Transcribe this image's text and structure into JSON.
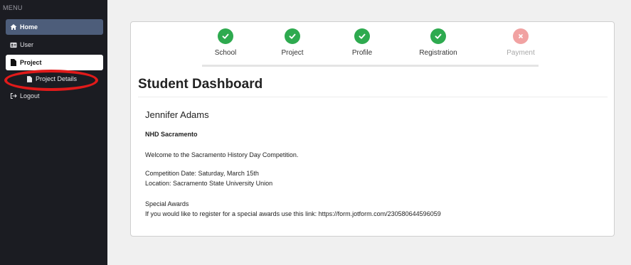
{
  "sidebar": {
    "menu_label": "MENU",
    "items": [
      {
        "label": "Home"
      },
      {
        "label": "User"
      },
      {
        "label": "Project"
      },
      {
        "label": "Project Details"
      },
      {
        "label": "Logout"
      }
    ]
  },
  "steps": [
    {
      "label": "School",
      "status": "done"
    },
    {
      "label": "Project",
      "status": "done"
    },
    {
      "label": "Profile",
      "status": "done"
    },
    {
      "label": "Registration",
      "status": "done"
    },
    {
      "label": "Payment",
      "status": "failed"
    }
  ],
  "colors": {
    "sidebar_bg": "#1b1c22",
    "active_item": "#4d5d7a",
    "step_done": "#2eaa4f",
    "step_failed": "#f1a2a2",
    "annotation": "#e11a1a"
  },
  "dashboard": {
    "title": "Student Dashboard",
    "student_name": "Jennifer Adams",
    "organization": "NHD Sacramento",
    "welcome": "Welcome to the Sacramento History Day Competition.",
    "competition_date": "Competition Date: Saturday, March 15th",
    "location": "Location: Sacramento State University Union",
    "awards_title": "Special Awards",
    "awards_text": "If you would like to register for a special awards use this link: https://form.jotform.com/230580644596059"
  }
}
